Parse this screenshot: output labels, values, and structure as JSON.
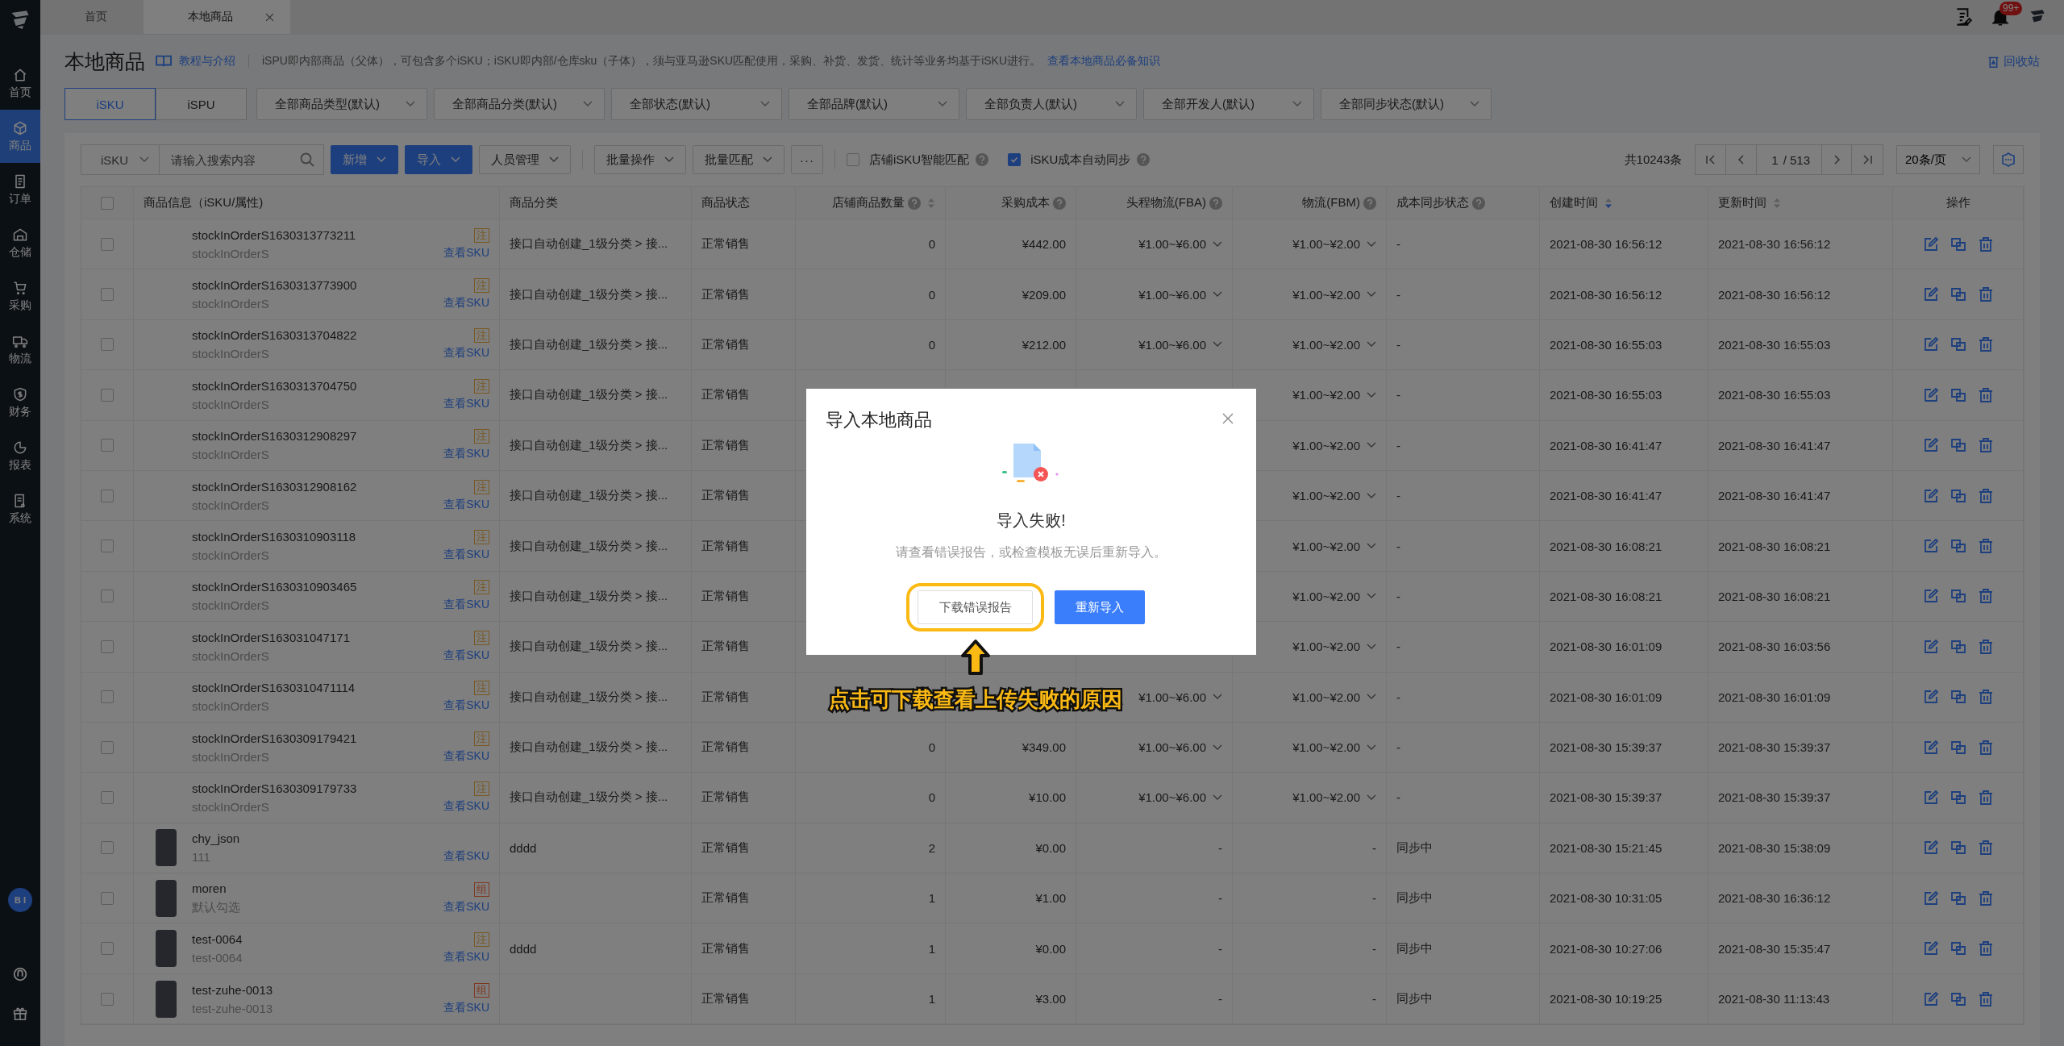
{
  "tabs": [
    {
      "label": "首页",
      "selected": false,
      "closable": false
    },
    {
      "label": "本地商品",
      "selected": true,
      "closable": true
    }
  ],
  "header": {
    "notification_badge": "99+"
  },
  "sidebar": {
    "items": [
      {
        "label": "首页",
        "selected": false
      },
      {
        "label": "商品",
        "selected": true
      },
      {
        "label": "订单",
        "selected": false
      },
      {
        "label": "仓储",
        "selected": false
      },
      {
        "label": "采购",
        "selected": false
      },
      {
        "label": "物流",
        "selected": false
      },
      {
        "label": "财务",
        "selected": false
      },
      {
        "label": "报表",
        "selected": false
      },
      {
        "label": "系统",
        "selected": false
      }
    ],
    "bi_badge": "B I"
  },
  "page": {
    "title": "本地商品",
    "tutorial_link": "教程与介绍",
    "description": "iSPU即内部商品（父体），可包含多个iSKU；iSKU即内部/仓库sku（子体），须与亚马逊SKU匹配使用，采购、补货、发货、统计等业务均基于iSKU进行。",
    "knowledge_link": "查看本地商品必备知识",
    "recycle_bin": "回收站"
  },
  "view_toggle": [
    {
      "label": "iSKU",
      "selected": true
    },
    {
      "label": "iSPU",
      "selected": false
    }
  ],
  "filters": [
    "全部商品类型(默认)",
    "全部商品分类(默认)",
    "全部状态(默认)",
    "全部品牌(默认)",
    "全部负责人(默认)",
    "全部开发人(默认)",
    "全部同步状态(默认)"
  ],
  "toolbar": {
    "search_type": "iSKU",
    "search_placeholder": "请输入搜索内容",
    "button_groups": [
      [
        {
          "label": "新增",
          "kind": "primary"
        },
        {
          "label": "导入",
          "kind": "primary"
        },
        {
          "label": "人员管理",
          "kind": "dropdown"
        }
      ],
      [
        {
          "label": "批量操作",
          "kind": "dropdown"
        },
        {
          "label": "批量匹配",
          "kind": "dropdown"
        },
        {
          "label": "···",
          "kind": "plain"
        }
      ]
    ],
    "checkboxes": [
      {
        "label": "店铺iSKU智能匹配",
        "checked": false
      },
      {
        "label": "iSKU成本自动同步",
        "checked": true
      }
    ]
  },
  "pagination": {
    "total": "共10243条",
    "page": "1",
    "pages": "/ 513",
    "page_size": "20条/页"
  },
  "table": {
    "select_all": {
      "checked": false
    },
    "columns": [
      {
        "label": "商品信息（iSKU/属性)",
        "help": false
      },
      {
        "label": "商品分类",
        "help": false
      },
      {
        "label": "商品状态",
        "help": false
      },
      {
        "label": "店铺商品数量",
        "help": true,
        "sorted": false
      },
      {
        "label": "采购成本",
        "help": true
      },
      {
        "label": "头程物流(FBA)",
        "help": true
      },
      {
        "label": "物流(FBM)",
        "help": true
      },
      {
        "label": "成本同步状态",
        "help": true
      },
      {
        "label": "创建时间",
        "help": false,
        "sorted": true
      },
      {
        "label": "更新时间",
        "help": false,
        "sorted": false
      },
      {
        "label": "操作",
        "help": false
      }
    ],
    "rows": [
      {
        "selected": false,
        "photo": false,
        "name": "stockInOrderS1630313773211",
        "sub": "stockInOrderS",
        "tag": {
          "text": "注",
          "kind": "standard"
        },
        "link": "查看SKU",
        "category": "接口自动创建_1级分类 > 接...",
        "status": "正常销售",
        "count": "0",
        "cost": "¥442.00",
        "fba": "¥1.00~¥6.00",
        "fbm": "¥1.00~¥2.00",
        "menus": true,
        "sync": "-",
        "created": "2021-08-30 16:56:12",
        "updated": "2021-08-30 16:56:12"
      },
      {
        "selected": false,
        "photo": false,
        "name": "stockInOrderS1630313773900",
        "sub": "stockInOrderS",
        "tag": {
          "text": "注",
          "kind": "standard"
        },
        "link": "查看SKU",
        "category": "接口自动创建_1级分类 > 接...",
        "status": "正常销售",
        "count": "0",
        "cost": "¥209.00",
        "fba": "¥1.00~¥6.00",
        "fbm": "¥1.00~¥2.00",
        "menus": true,
        "sync": "-",
        "created": "2021-08-30 16:56:12",
        "updated": "2021-08-30 16:56:12"
      },
      {
        "selected": false,
        "photo": false,
        "name": "stockInOrderS1630313704822",
        "sub": "stockInOrderS",
        "tag": {
          "text": "注",
          "kind": "standard"
        },
        "link": "查看SKU",
        "category": "接口自动创建_1级分类 > 接...",
        "status": "正常销售",
        "count": "0",
        "cost": "¥212.00",
        "fba": "¥1.00~¥6.00",
        "fbm": "¥1.00~¥2.00",
        "menus": true,
        "sync": "-",
        "created": "2021-08-30 16:55:03",
        "updated": "2021-08-30 16:55:03"
      },
      {
        "selected": false,
        "photo": false,
        "name": "stockInOrderS1630313704750",
        "sub": "stockInOrderS",
        "tag": {
          "text": "注",
          "kind": "standard"
        },
        "link": "查看SKU",
        "category": "接口自动创建_1级分类 > 接...",
        "status": "正常销售",
        "fbm": "¥1.00~¥2.00",
        "menus": true,
        "sync": "-",
        "created": "2021-08-30 16:55:03",
        "updated": "2021-08-30 16:55:03"
      },
      {
        "selected": false,
        "photo": false,
        "name": "stockInOrderS1630312908297",
        "sub": "stockInOrderS",
        "tag": {
          "text": "注",
          "kind": "standard"
        },
        "link": "查看SKU",
        "category": "接口自动创建_1级分类 > 接...",
        "status": "正常销售",
        "fbm": "¥1.00~¥2.00",
        "menus": true,
        "sync": "-",
        "created": "2021-08-30 16:41:47",
        "updated": "2021-08-30 16:41:47"
      },
      {
        "selected": false,
        "photo": false,
        "name": "stockInOrderS1630312908162",
        "sub": "stockInOrderS",
        "tag": {
          "text": "注",
          "kind": "standard"
        },
        "link": "查看SKU",
        "category": "接口自动创建_1级分类 > 接...",
        "status": "正常销售",
        "fbm": "¥1.00~¥2.00",
        "menus": true,
        "sync": "-",
        "created": "2021-08-30 16:41:47",
        "updated": "2021-08-30 16:41:47"
      },
      {
        "selected": false,
        "photo": false,
        "name": "stockInOrderS1630310903118",
        "sub": "stockInOrderS",
        "tag": {
          "text": "注",
          "kind": "standard"
        },
        "link": "查看SKU",
        "category": "接口自动创建_1级分类 > 接...",
        "status": "正常销售",
        "fbm": "¥1.00~¥2.00",
        "menus": true,
        "sync": "-",
        "created": "2021-08-30 16:08:21",
        "updated": "2021-08-30 16:08:21"
      },
      {
        "selected": false,
        "photo": false,
        "name": "stockInOrderS1630310903465",
        "sub": "stockInOrderS",
        "tag": {
          "text": "注",
          "kind": "standard"
        },
        "link": "查看SKU",
        "category": "接口自动创建_1级分类 > 接...",
        "status": "正常销售",
        "fbm": "¥1.00~¥2.00",
        "menus": true,
        "sync": "-",
        "created": "2021-08-30 16:08:21",
        "updated": "2021-08-30 16:08:21"
      },
      {
        "selected": false,
        "photo": false,
        "name": "stockInOrderS163031047171",
        "sub": "stockInOrderS",
        "tag": {
          "text": "注",
          "kind": "standard"
        },
        "link": "查看SKU",
        "category": "接口自动创建_1级分类 > 接...",
        "status": "正常销售",
        "fbm": "¥1.00~¥2.00",
        "menus": true,
        "sync": "-",
        "created": "2021-08-30 16:01:09",
        "updated": "2021-08-30 16:03:56"
      },
      {
        "selected": false,
        "photo": false,
        "name": "stockInOrderS1630310471114",
        "sub": "stockInOrderS",
        "tag": {
          "text": "注",
          "kind": "standard"
        },
        "link": "查看SKU",
        "category": "接口自动创建_1级分类 > 接...",
        "status": "正常销售",
        "fba": "¥1.00~¥6.00",
        "fbm": "¥1.00~¥2.00",
        "menus": true,
        "sync": "-",
        "created": "2021-08-30 16:01:09",
        "updated": "2021-08-30 16:01:09"
      },
      {
        "selected": false,
        "photo": false,
        "name": "stockInOrderS1630309179421",
        "sub": "stockInOrderS",
        "tag": {
          "text": "注",
          "kind": "standard"
        },
        "link": "查看SKU",
        "category": "接口自动创建_1级分类 > 接...",
        "status": "正常销售",
        "count": "0",
        "cost": "¥349.00",
        "fba": "¥1.00~¥6.00",
        "fbm": "¥1.00~¥2.00",
        "menus": true,
        "sync": "-",
        "created": "2021-08-30 15:39:37",
        "updated": "2021-08-30 15:39:37"
      },
      {
        "selected": false,
        "photo": false,
        "name": "stockInOrderS1630309179733",
        "sub": "stockInOrderS",
        "tag": {
          "text": "注",
          "kind": "standard"
        },
        "link": "查看SKU",
        "category": "接口自动创建_1级分类 > 接...",
        "status": "正常销售",
        "count": "0",
        "cost": "¥10.00",
        "fba": "¥1.00~¥6.00",
        "fbm": "¥1.00~¥2.00",
        "menus": true,
        "sync": "-",
        "created": "2021-08-30 15:39:37",
        "updated": "2021-08-30 15:39:37"
      },
      {
        "selected": false,
        "photo": true,
        "name": "chy_json",
        "sub": "111",
        "link": "查看SKU",
        "category": "dddd",
        "status": "正常销售",
        "count": "2",
        "cost": "¥0.00",
        "fba": "-",
        "fbm": "-",
        "menus": false,
        "sync": "同步中",
        "created": "2021-08-30 15:21:45",
        "updated": "2021-08-30 15:38:09"
      },
      {
        "selected": false,
        "photo": true,
        "name": "moren",
        "sub": "默认勾选",
        "tag": {
          "text": "组",
          "kind": "bundle"
        },
        "link": "查看SKU",
        "status": "正常销售",
        "count": "1",
        "cost": "¥1.00",
        "fba": "-",
        "fbm": "-",
        "menus": false,
        "sync": "同步中",
        "created": "2021-08-30 10:31:05",
        "updated": "2021-08-30 16:36:12"
      },
      {
        "selected": false,
        "photo": true,
        "name": "test-0064",
        "sub": "test-0064",
        "tag": {
          "text": "注",
          "kind": "standard"
        },
        "link": "查看SKU",
        "category": "dddd",
        "status": "正常销售",
        "count": "1",
        "cost": "¥0.00",
        "fba": "-",
        "fbm": "-",
        "menus": false,
        "sync": "同步中",
        "created": "2021-08-30 10:27:06",
        "updated": "2021-08-30 15:35:47"
      },
      {
        "selected": false,
        "photo": true,
        "name": "test-zuhe-0013",
        "sub": "test-zuhe-0013",
        "tag": {
          "text": "组",
          "kind": "bundle"
        },
        "link": "查看SKU",
        "status": "正常销售",
        "count": "1",
        "cost": "¥3.00",
        "fba": "-",
        "fbm": "-",
        "menus": false,
        "sync": "同步中",
        "created": "2021-08-30 10:19:25",
        "updated": "2021-08-30 11:13:43"
      }
    ]
  },
  "dialog": {
    "title": "导入本地商品",
    "heading": "导入失败!",
    "message": "请查看错误报告，或检查模板无误后重新导入。",
    "buttons": [
      {
        "label": "下载错误报告",
        "kind": "default",
        "highlighted": true
      },
      {
        "label": "重新导入",
        "kind": "primary",
        "highlighted": false
      }
    ]
  },
  "callout": {
    "text": "点击可下载查看上传失败的原因"
  }
}
